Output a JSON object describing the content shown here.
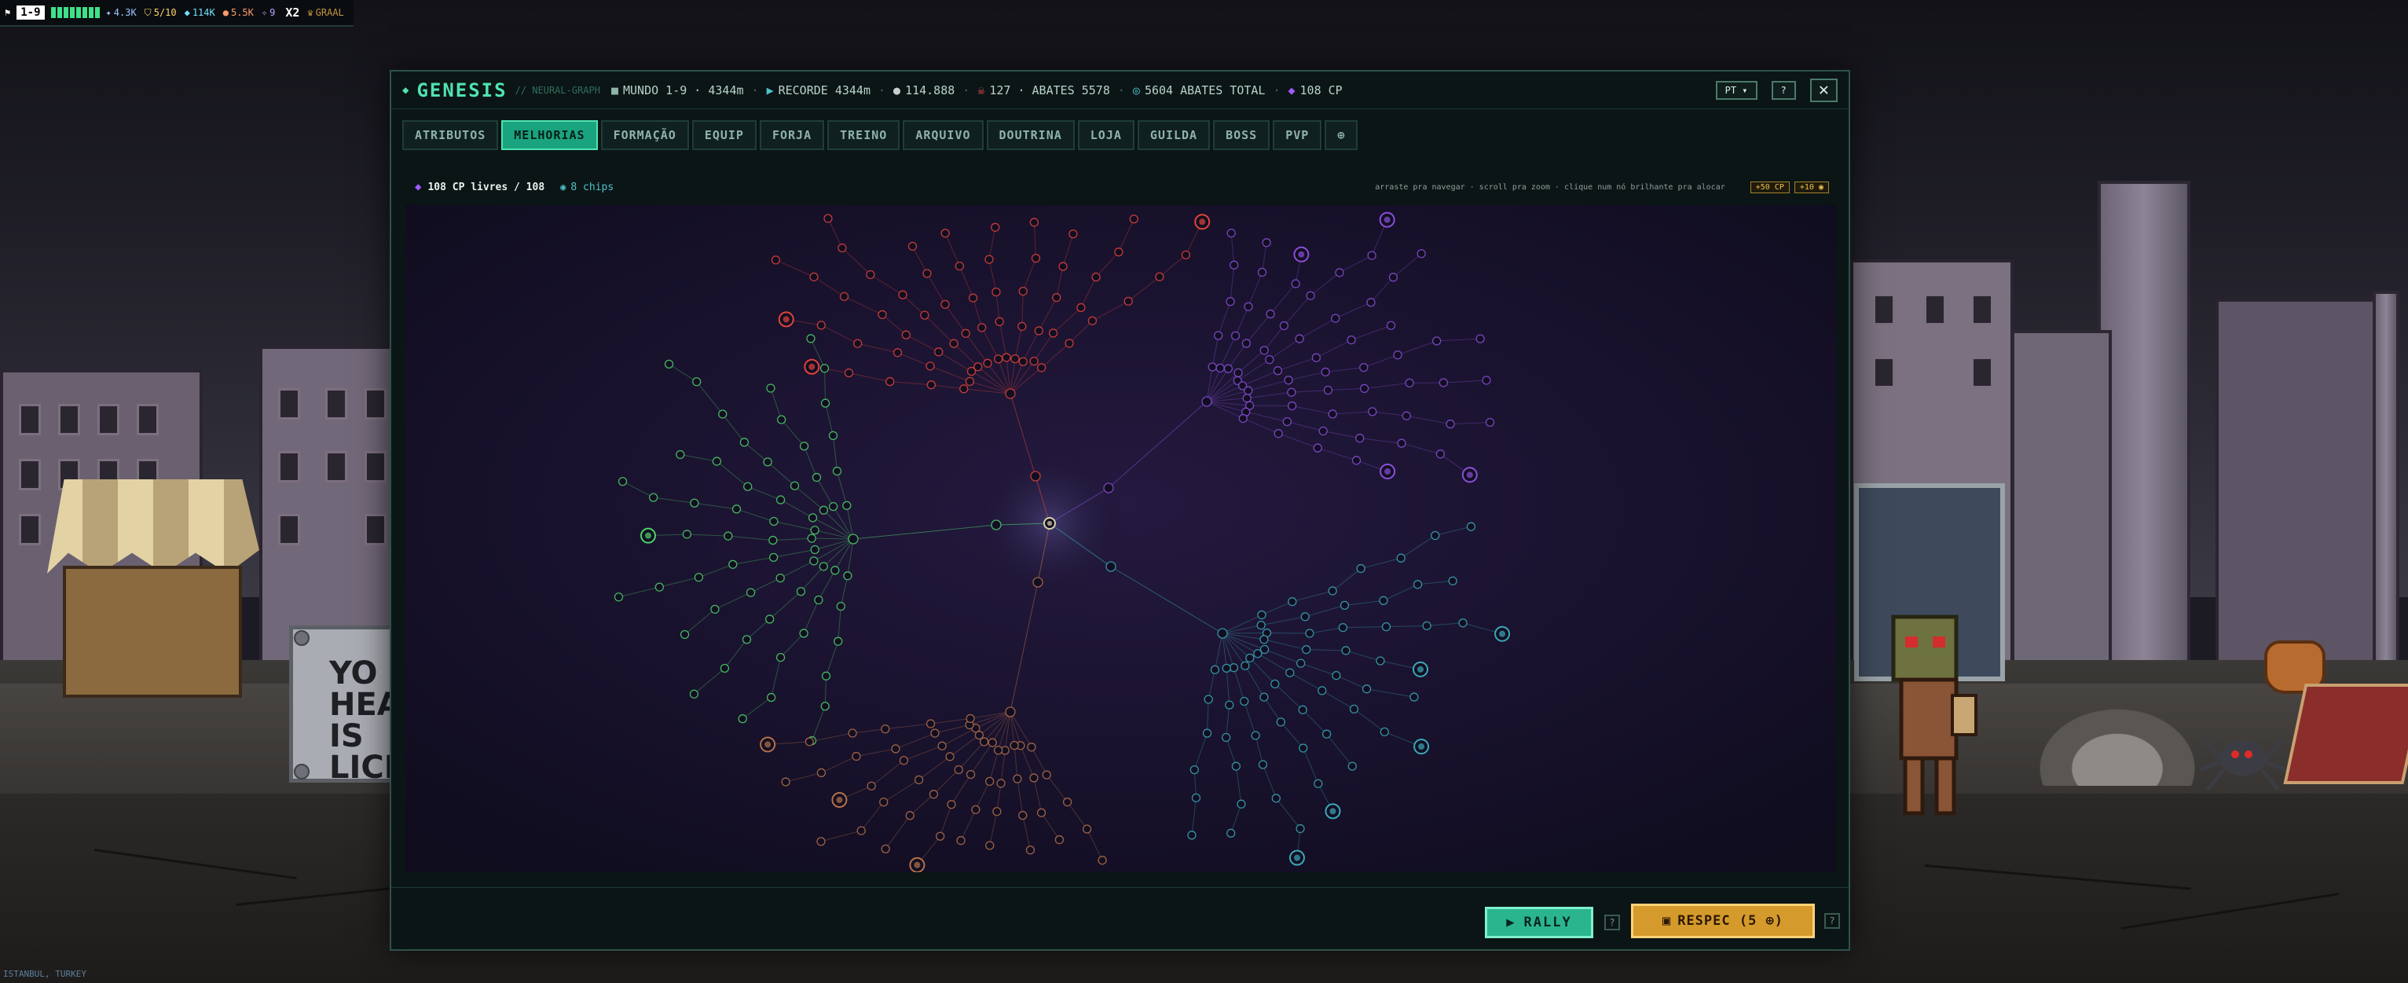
{
  "hud": {
    "stage": "1-9",
    "energy_bars": 8,
    "items": [
      {
        "icon": "sword-icon",
        "value": "4.3K",
        "color": "#9fc4ff"
      },
      {
        "icon": "shield-icon",
        "value": "5/10",
        "color": "#ffd66b"
      },
      {
        "icon": "gem-icon",
        "value": "114K",
        "color": "#6fe0ff"
      },
      {
        "icon": "coin-icon",
        "value": "5.5K",
        "color": "#ff9a6b"
      },
      {
        "icon": "star-icon",
        "value": "9",
        "color": "#b7a2ff"
      },
      {
        "icon": "multiplier-icon",
        "value": "X2",
        "color": "#ffffff"
      },
      {
        "icon": "crown-icon",
        "value": "GRAAL",
        "color": "#c3923f"
      }
    ]
  },
  "modal": {
    "title": "GENESIS",
    "subtitle": "// NEURAL-GRAPH",
    "stats": [
      {
        "icon": "world-icon",
        "text": "MUNDO 1-9 · 4344m"
      },
      {
        "icon": "flag-icon",
        "text": "RECORDE 4344m"
      },
      {
        "icon": "coin-icon",
        "text": "114.888"
      },
      {
        "icon": "skull-icon",
        "text": "127 · ABATES 5578"
      },
      {
        "icon": "target-icon",
        "text": "5604 ABATES TOTAL"
      },
      {
        "icon": "diamond-icon",
        "text": "108 CP"
      }
    ],
    "language": "PT ▾",
    "help": "?",
    "close": "✕"
  },
  "tabs": [
    {
      "label": "ATRIBUTOS",
      "active": false
    },
    {
      "label": "MELHORIAS",
      "active": true
    },
    {
      "label": "FORMAÇÃO",
      "active": false
    },
    {
      "label": "EQUIP",
      "active": false
    },
    {
      "label": "FORJA",
      "active": false
    },
    {
      "label": "TREINO",
      "active": false
    },
    {
      "label": "ARQUIVO",
      "active": false
    },
    {
      "label": "DOUTRINA",
      "active": false
    },
    {
      "label": "LOJA",
      "active": false
    },
    {
      "label": "GUILDA",
      "active": false
    },
    {
      "label": "BOSS",
      "active": false
    },
    {
      "label": "PVP",
      "active": false
    },
    {
      "label": "⊕",
      "active": false
    }
  ],
  "info": {
    "cp_free": "108 CP livres / 108",
    "chips": "8 chips",
    "hint": "arraste pra navegar · scroll pra zoom · clique num nó brilhante pra alocar",
    "btn_cp": "+50 CP",
    "btn_chip": "+10 ◉"
  },
  "tree": {
    "branches": [
      {
        "name": "green",
        "color": "#4fd16b"
      },
      {
        "name": "red",
        "color": "#e0433c"
      },
      {
        "name": "purple",
        "color": "#8a4fd8"
      },
      {
        "name": "cyan",
        "color": "#3aa8b8"
      },
      {
        "name": "orange",
        "color": "#b4704a"
      }
    ]
  },
  "actions": {
    "rally": "RALLY",
    "respec": "RESPEC (5 ⊕)",
    "rally_hint": "?",
    "respec_hint": "?"
  },
  "world": {
    "sign_text": "YO HEAR IS LICEN",
    "location": "ISTANBUL, TURKEY"
  }
}
